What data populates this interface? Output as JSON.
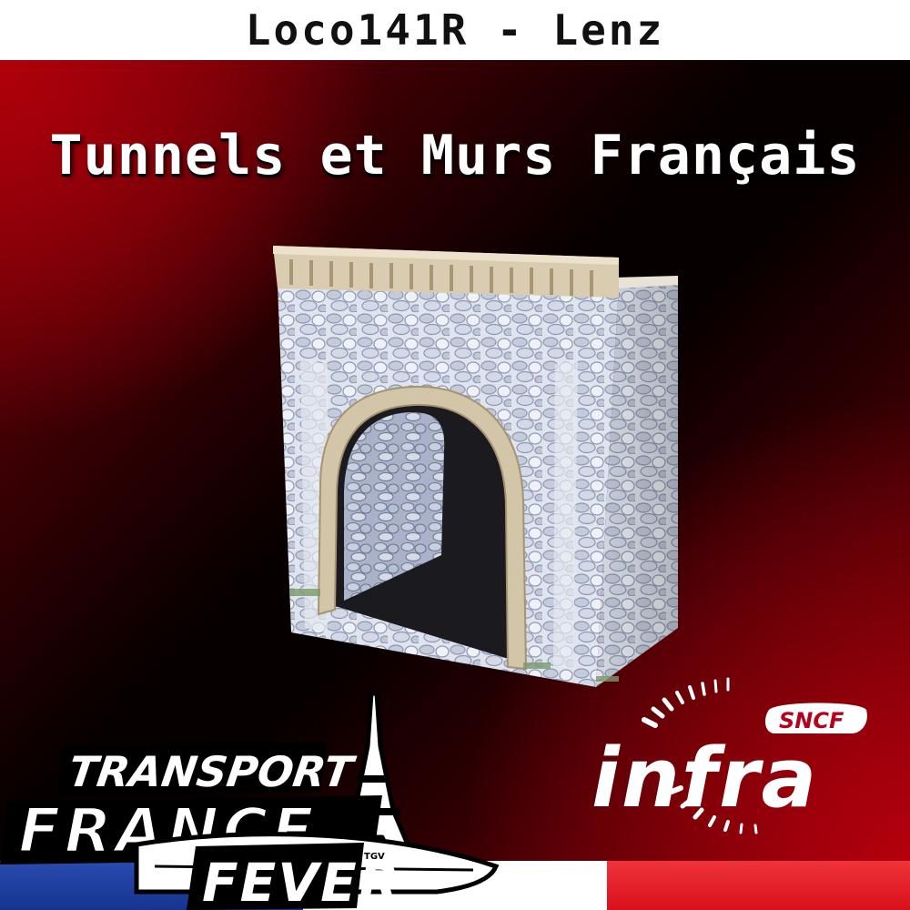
{
  "header": {
    "title": "Loco141R - Lenz"
  },
  "main": {
    "title": "Tunnels et Murs Français"
  },
  "logos": {
    "transport_france_fever": {
      "line1": "TRANSPORT",
      "line2": "FRANCE",
      "line3": "FEVER",
      "train_mark": "TGV",
      "icon": "eiffel-tower-icon"
    },
    "sncf_infra": {
      "badge": "SNCF",
      "word": "infra"
    }
  },
  "colors": {
    "accent_red": "#c00010",
    "flag_blue": "#1c3fa6",
    "flag_white": "#ffffff",
    "flag_red": "#e8202a"
  }
}
